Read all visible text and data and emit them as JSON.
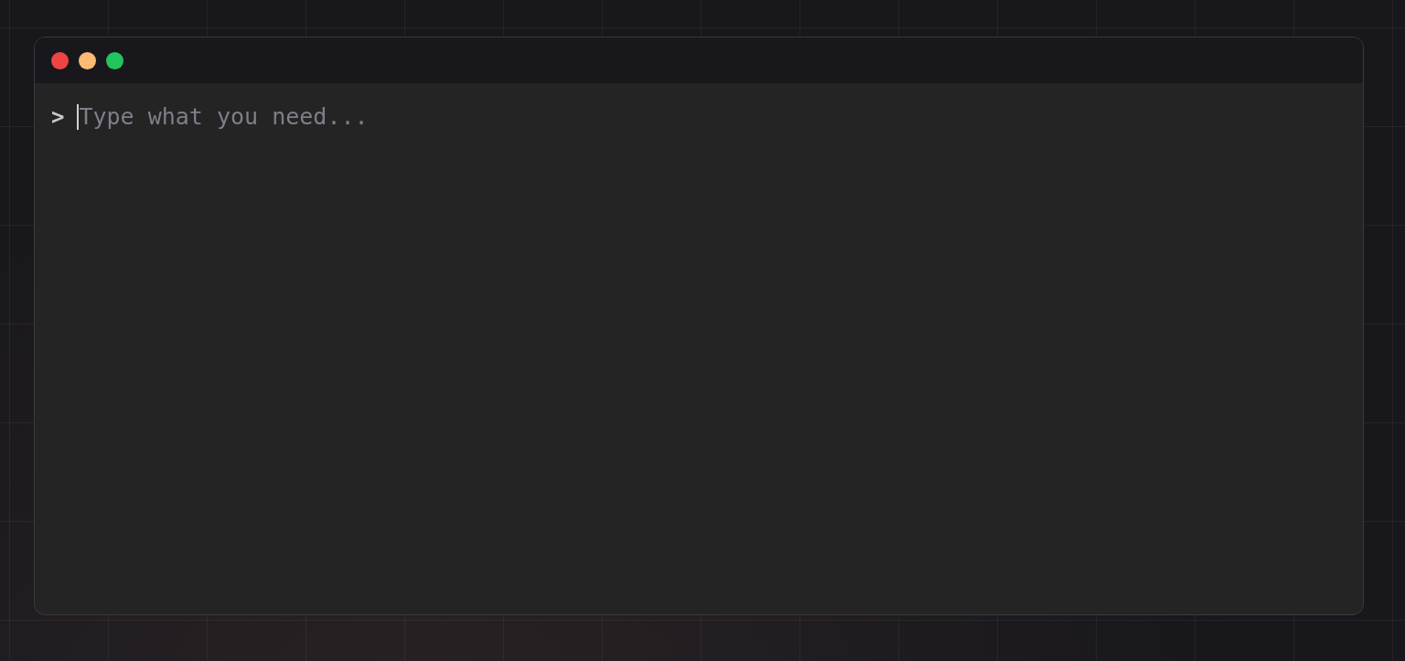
{
  "window": {
    "controls": [
      {
        "color": "#ef4444"
      },
      {
        "color": "#fdba74"
      },
      {
        "color": "#22c55e"
      }
    ]
  },
  "prompt": {
    "symbol": ">",
    "placeholder": "Type what you need..."
  }
}
